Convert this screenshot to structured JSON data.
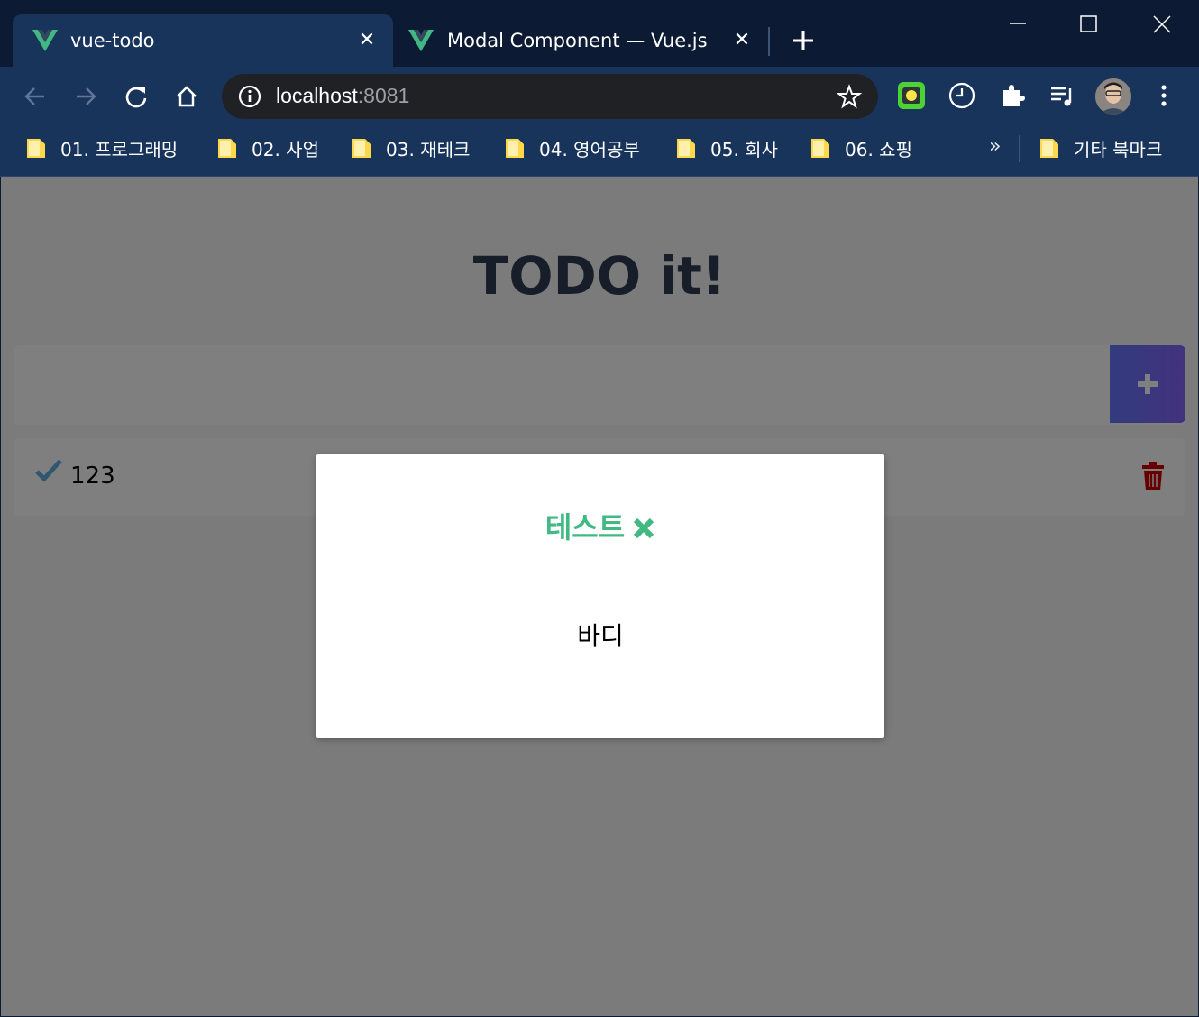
{
  "browser": {
    "tabs": [
      {
        "title": "vue-todo",
        "active": true
      },
      {
        "title": "Modal Component — Vue.js",
        "active": false
      }
    ],
    "address_bar": {
      "host": "localhost",
      "port": ":8081"
    },
    "bookmarks": [
      {
        "label": "01. 프로그래밍"
      },
      {
        "label": "02. 사업"
      },
      {
        "label": "03. 재테크"
      },
      {
        "label": "04. 영어공부"
      },
      {
        "label": "05. 회사"
      },
      {
        "label": "06. 쇼핑"
      }
    ],
    "bookmarks_more": "»",
    "other_bookmarks": "기타 북마크"
  },
  "app": {
    "title": "TODO it!",
    "todo_items": [
      {
        "text": "123"
      }
    ]
  },
  "modal": {
    "header": "테스트",
    "body": "바디"
  },
  "colors": {
    "accent_green": "#42b983",
    "title_text": "#2f3b52",
    "add_button_gradient_start": "#6478fb",
    "add_button_gradient_end": "#8763fb",
    "trash": "#cc0000",
    "check": "#62acde"
  }
}
